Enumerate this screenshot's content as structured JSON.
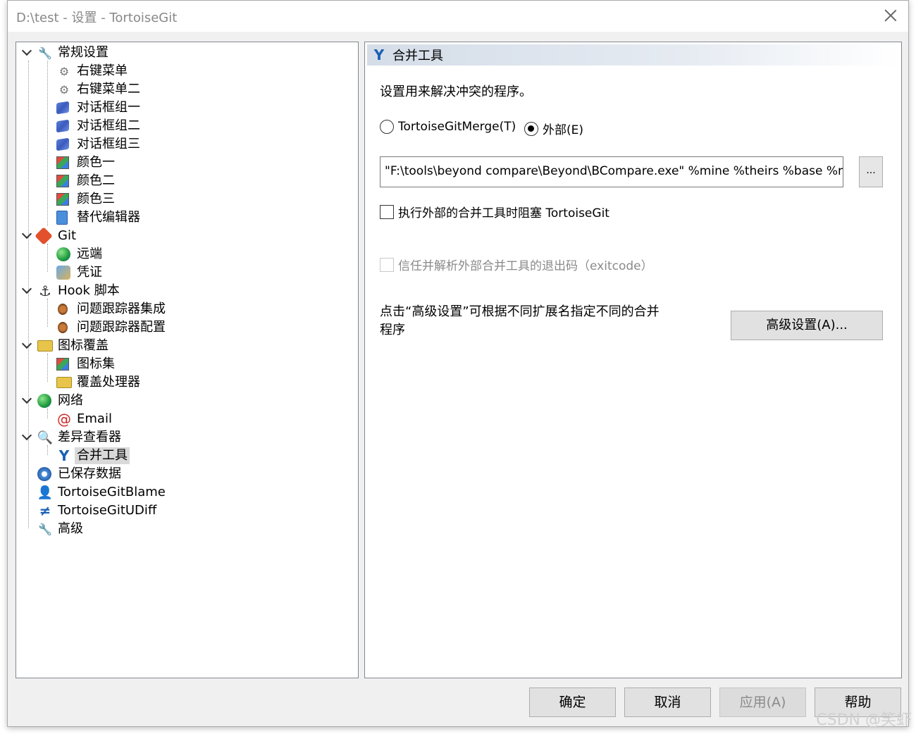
{
  "window": {
    "title": "D:\\test - 设置 - TortoiseGit"
  },
  "tree": {
    "items": [
      {
        "label": "常规设置",
        "icon": "wrench-icon"
      },
      {
        "label": "右键菜单",
        "icon": "gear-icon"
      },
      {
        "label": "右键菜单二",
        "icon": "gear-icon"
      },
      {
        "label": "对话框组一",
        "icon": "window-icon"
      },
      {
        "label": "对话框组二",
        "icon": "window-icon"
      },
      {
        "label": "对话框组三",
        "icon": "window-icon"
      },
      {
        "label": "颜色一",
        "icon": "color-icon"
      },
      {
        "label": "颜色二",
        "icon": "color-icon"
      },
      {
        "label": "颜色三",
        "icon": "color-icon"
      },
      {
        "label": "替代编辑器",
        "icon": "editor-icon"
      },
      {
        "label": "Git",
        "icon": "git-icon"
      },
      {
        "label": "远端",
        "icon": "globe-icon"
      },
      {
        "label": "凭证",
        "icon": "credential-icon"
      },
      {
        "label": "Hook 脚本",
        "icon": "hook-icon"
      },
      {
        "label": "问题跟踪器集成",
        "icon": "bug-icon"
      },
      {
        "label": "问题跟踪器配置",
        "icon": "bug-icon"
      },
      {
        "label": "图标覆盖",
        "icon": "folder-icon"
      },
      {
        "label": "图标集",
        "icon": "color-icon"
      },
      {
        "label": "覆盖处理器",
        "icon": "folder-icon"
      },
      {
        "label": "网络",
        "icon": "globe-icon"
      },
      {
        "label": "Email",
        "icon": "at-icon"
      },
      {
        "label": "差异查看器",
        "icon": "magnifier-icon"
      },
      {
        "label": "合并工具",
        "icon": "merge-icon"
      },
      {
        "label": "已保存数据",
        "icon": "saved-data-icon"
      },
      {
        "label": "TortoiseGitBlame",
        "icon": "blame-icon"
      },
      {
        "label": "TortoiseGitUDiff",
        "icon": "udiff-icon"
      },
      {
        "label": "高级",
        "icon": "wrench-icon"
      }
    ],
    "selected": "合并工具"
  },
  "panel": {
    "header": "合并工具",
    "description": "设置用来解决冲突的程序。",
    "radio_tortoise": "TortoiseGitMerge(T)",
    "radio_external": "外部(E)",
    "external_selected": true,
    "path_value": "\"F:\\tools\\beyond compare\\Beyond\\BCompare.exe\" %mine %theirs %base %merged",
    "browse_label": "...",
    "block_checkbox": "执行外部的合并工具时阻塞 TortoiseGit",
    "exitcode_checkbox": "信任并解析外部合并工具的退出码（exitcode）",
    "hint": "点击“高级设置”可根据不同扩展名指定不同的合并程序",
    "advanced_button": "高级设置(A)..."
  },
  "buttons": {
    "ok": "确定",
    "cancel": "取消",
    "apply": "应用(A)",
    "help": "帮助"
  },
  "watermark": "CSDN @笑虾"
}
